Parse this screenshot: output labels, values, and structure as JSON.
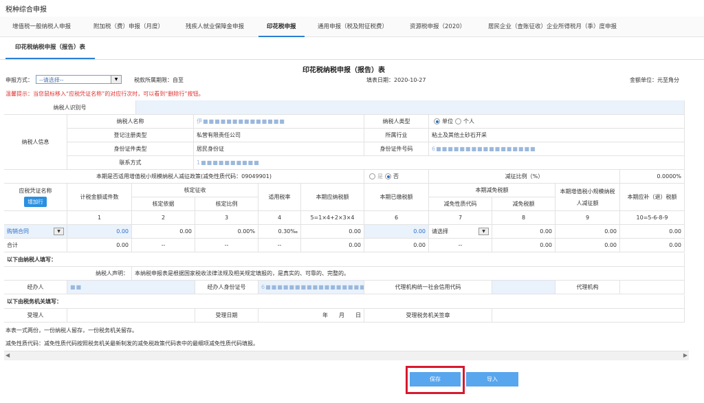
{
  "window_title": "税种综合申报",
  "tabs": [
    "增值税一般纳税人申报",
    "附加税（费）申报（月度）",
    "残疾人就业保障金申报",
    "印花税申报",
    "通用申报（税及附征税费）",
    "资源税申报（2020）",
    "居民企业（查账征收）企业所得税月（季）度申报"
  ],
  "active_tab": "印花税申报",
  "subtab": "印花税纳税申报（报告）表",
  "form_title": "印花税纳税申报（报告）表",
  "meta": {
    "method_label": "申报方式：",
    "method_value": "--请选择--",
    "period_label": "税款所属期限：自至",
    "date_label": "填表日期：2020-10-27",
    "unit_label": "金额单位：元至角分"
  },
  "warning": "温馨提示：当您鼠标移入“应税凭证名称”的对应行次时，可以看到“删除行”按钮。",
  "taxpayer": {
    "id_label": "纳税人识别号",
    "section_label": "纳税人信息",
    "name_label": "纳税人名称",
    "name_value": "伊■■■■■■■■■■■■■■",
    "type_label": "纳税人类型",
    "type_opt1": "单位",
    "type_opt2": "个人",
    "reg_label": "登记注册类型",
    "reg_value": "私营有限责任公司",
    "industry_label": "所属行业",
    "industry_value": "粘土及其他土砂石开采",
    "idtype_label": "身份证件类型",
    "idtype_value": "居民身份证",
    "idno_label": "身份证件号码",
    "idno_value": "6■■■■■■■■■■■■■■■■■",
    "contact_label": "联系方式",
    "contact_value": "1■■■■■■■■■■"
  },
  "policy": {
    "question": "本期是否适用增值税小规模纳税人减征政策(减免性质代码：09049901)",
    "yes": "是",
    "no": "否",
    "ratio_label": "减征比例（%）",
    "ratio_value": "0.0000%"
  },
  "table": {
    "h_name": "应税凭证名称",
    "add_row": "增加行",
    "h_amount": "计税金额或件数",
    "h_verify": "核定征收",
    "h_verify_basis": "核定依据",
    "h_verify_ratio": "核定比例",
    "h_rate": "适用税率",
    "h_payable": "本期应纳税额",
    "h_paid": "本期已缴税额",
    "h_relief": "本期减免税额",
    "h_relief_code": "减免性质代码",
    "h_relief_amount": "减免税额",
    "h_small_1": "本期增值税小规模纳税",
    "h_small_2": "人减征额",
    "h_refund": "本期应补（退）税额",
    "nums": [
      "1",
      "2",
      "3",
      "4",
      "5=1×4+2×3×4",
      "6",
      "7",
      "8",
      "9",
      "10=5-6-8-9"
    ],
    "row": {
      "name": "购销合同",
      "amount": "0.00",
      "basis": "0.00",
      "ratio": "0.00%",
      "rate": "0.30‰",
      "payable": "0.00",
      "paid": "0.00",
      "code": "请选择",
      "relief": "0.00",
      "small": "0.00",
      "refund": "0.00"
    },
    "total": {
      "label": "合计",
      "amount": "0.00",
      "basis": "--",
      "ratio": "--",
      "rate": "--",
      "payable": "0.00",
      "paid": "0.00",
      "code": "--",
      "relief": "0.00",
      "small": "0.00",
      "refund": "0.00"
    }
  },
  "declare": {
    "section": "以下由纳税人填写：",
    "stmt_label": "纳税人声明：",
    "stmt_text": "本纳税申报表是根据国家税收法律法规及相关规定填报的，是真实的、可靠的、完整的。",
    "agent_label": "经办人",
    "agent_value": "■■",
    "agent_id_label": "经办人身份证号",
    "agent_id_value": "6■■■■■■■■■■■■■■■■■",
    "org_code_label": "代理机构统一社会信用代码",
    "org_label": "代理机构"
  },
  "office": {
    "section": "以下由税务机关填写：",
    "receiver_label": "受理人",
    "date_label": "受理日期",
    "ymd": "年　　月　　日",
    "seal_label": "受理税务机关签章"
  },
  "notes": {
    "n1": "本表一式两份，一份纳税人留存，一份税务机关留存。",
    "n2": "减免性质代码：减免性质代码按照税务机关最新制发的减免税政策代码表中的最细项减免性质代码填报。"
  },
  "buttons": {
    "save": "保存",
    "import": "导入"
  },
  "colors": {
    "accent": "#2b7fd4",
    "warn": "#e23030",
    "button": "#58a6ee",
    "highlight": "#d8182d"
  }
}
